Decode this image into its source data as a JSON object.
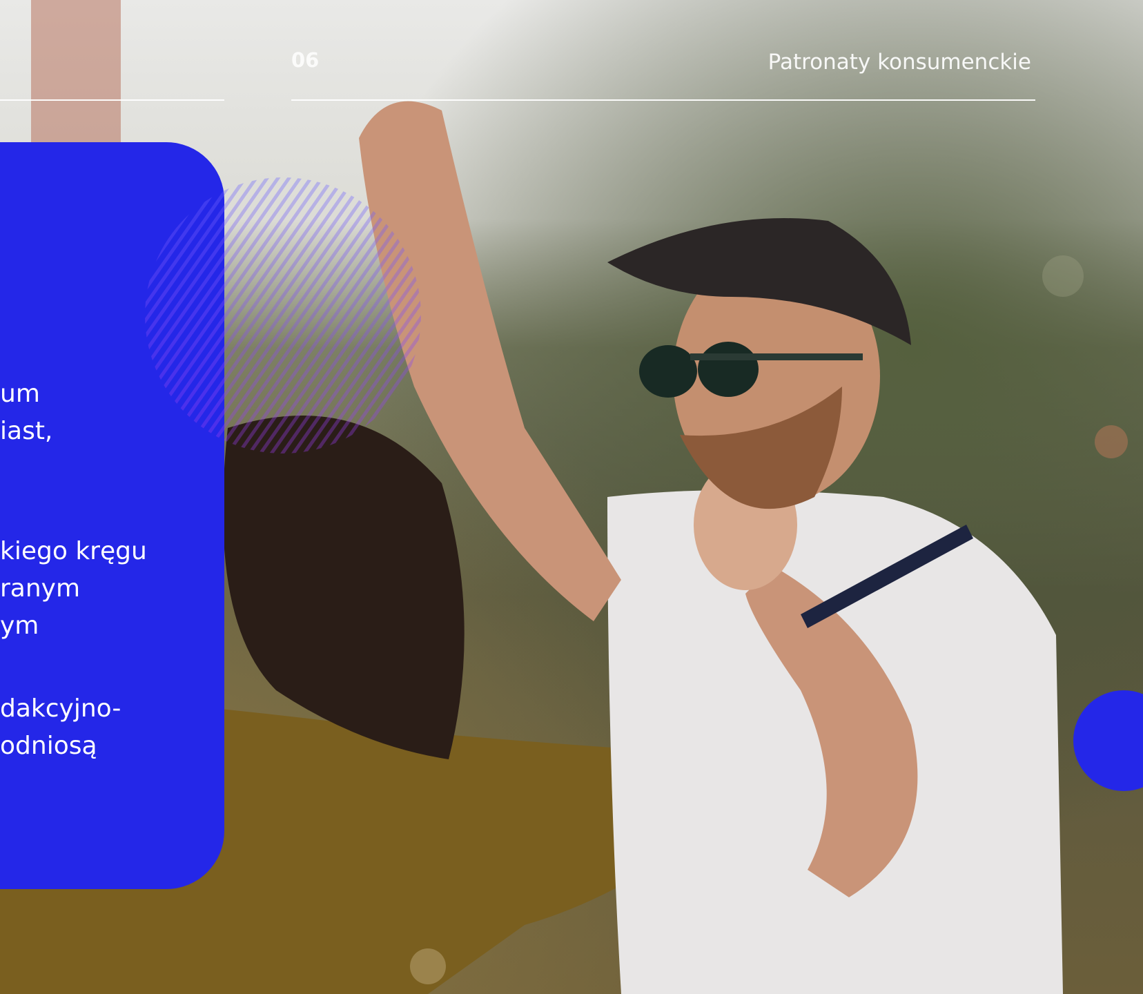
{
  "header": {
    "page_number": "06",
    "section_title": "Patronaty konsumenckie"
  },
  "card": {
    "paragraph1": [
      "um",
      "iast,"
    ],
    "paragraph2": [
      "kiego kręgu",
      "ranym",
      "ym"
    ],
    "paragraph3": [
      "dakcyjno-",
      "odniosą"
    ]
  },
  "colors": {
    "accent_blue": "#2427e8",
    "hatch_violet": "#8a3cf0",
    "text_white": "#ffffff"
  },
  "photo": {
    "icon": "festival-dancing-couple-photo"
  }
}
